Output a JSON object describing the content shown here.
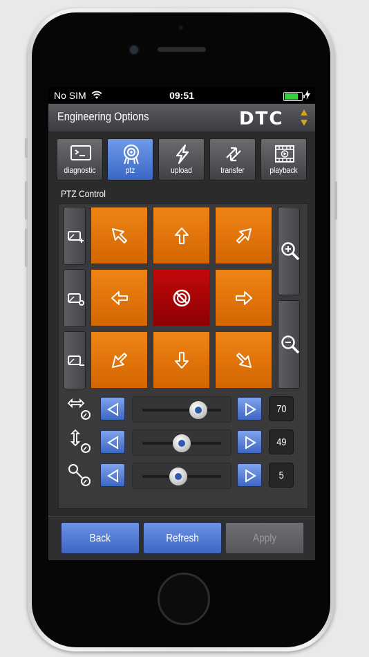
{
  "status_bar": {
    "carrier": "No SIM",
    "time": "09:51",
    "battery_color": "#39d03d",
    "battery_level": 0.8
  },
  "header": {
    "title": "Engineering Options",
    "logo": "DTC"
  },
  "tabs": [
    {
      "label": "diagnostic",
      "icon": "terminal-icon",
      "active": false
    },
    {
      "label": "ptz",
      "icon": "camera-icon",
      "active": true
    },
    {
      "label": "upload",
      "icon": "bolt-icon",
      "active": false
    },
    {
      "label": "transfer",
      "icon": "transfer-arrows-icon",
      "active": false
    },
    {
      "label": "playback",
      "icon": "film-play-icon",
      "active": false
    }
  ],
  "ptz": {
    "section_title": "PTZ Control",
    "left_buttons": [
      "preset-add-icon",
      "preset-settings-icon",
      "preset-remove-icon"
    ],
    "zoom_buttons": [
      "zoom-in-icon",
      "zoom-out-icon"
    ],
    "directions": [
      "up-left",
      "up",
      "up-right",
      "left",
      "stop",
      "right",
      "down-left",
      "down",
      "down-right"
    ]
  },
  "sliders": [
    {
      "name": "pan-speed",
      "icon": "pan-speed-icon",
      "value": "70",
      "level": 0.7
    },
    {
      "name": "tilt-speed",
      "icon": "tilt-speed-icon",
      "value": "49",
      "level": 0.49
    },
    {
      "name": "zoom-speed",
      "icon": "zoom-speed-icon",
      "value": "5",
      "level": 0.45
    }
  ],
  "footer": {
    "back_label": "Back",
    "refresh_label": "Refresh",
    "apply_label": "Apply"
  },
  "colors": {
    "accent_blue": "#3e66c3",
    "direction_orange": "#e07400",
    "stop_red": "#a40004",
    "screen_bg": "#2b2b2c"
  }
}
